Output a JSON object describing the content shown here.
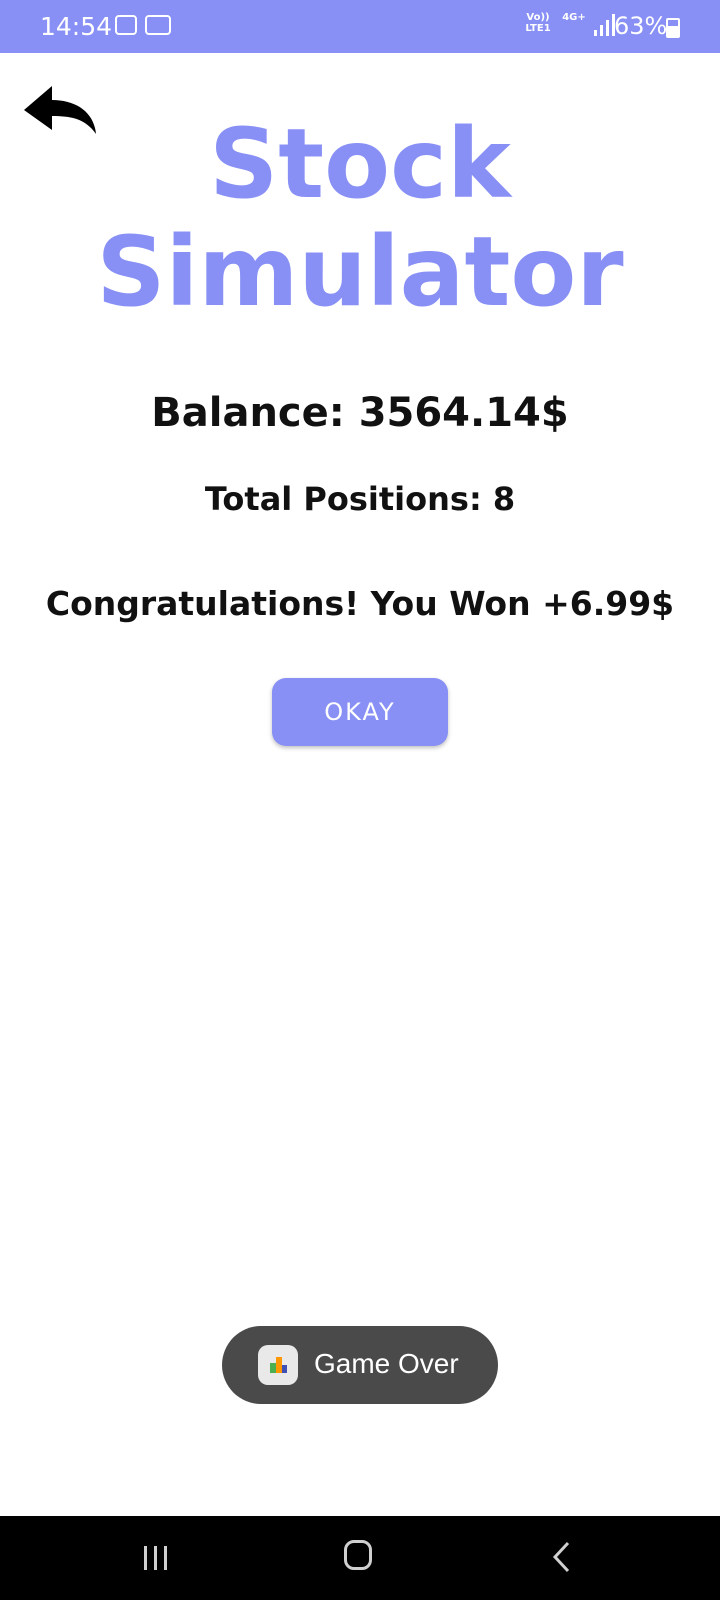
{
  "status_bar": {
    "time": "14:54",
    "volte_label": "Vo)) LTE1",
    "network_label": "4G+",
    "battery_percent": "63%",
    "icons": [
      "gallery-icon",
      "voicemail-icon",
      "signal-icon",
      "battery-icon"
    ]
  },
  "app": {
    "title_line1": "Stock",
    "title_line2": "Simulator",
    "accent_color": "#8890f5"
  },
  "main": {
    "balance_text": "Balance: 3564.14$",
    "positions_text": "Total Positions: 8",
    "result_text": "Congratulations! You Won +6.99$",
    "okay_label": "OKAY"
  },
  "toast": {
    "text": "Game Over"
  },
  "nav_bar": {
    "buttons": [
      "recents",
      "home",
      "back"
    ]
  }
}
